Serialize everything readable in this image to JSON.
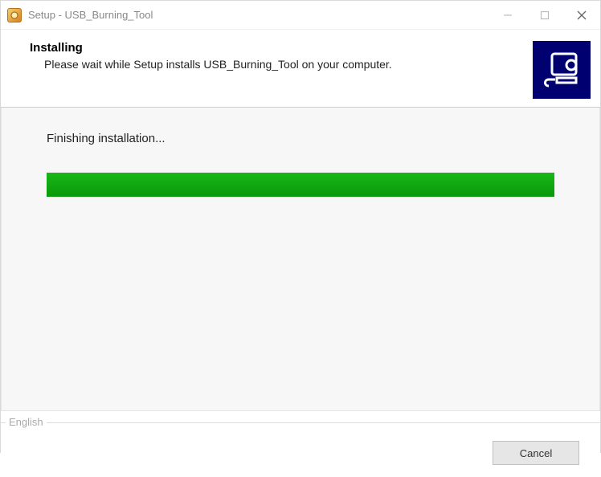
{
  "window": {
    "title": "Setup - USB_Burning_Tool"
  },
  "header": {
    "title": "Installing",
    "subtitle": "Please wait while Setup installs USB_Burning_Tool on your computer."
  },
  "content": {
    "status": "Finishing installation...",
    "progress_percent": 100
  },
  "language": {
    "label": "English"
  },
  "footer": {
    "cancel_label": "Cancel"
  }
}
